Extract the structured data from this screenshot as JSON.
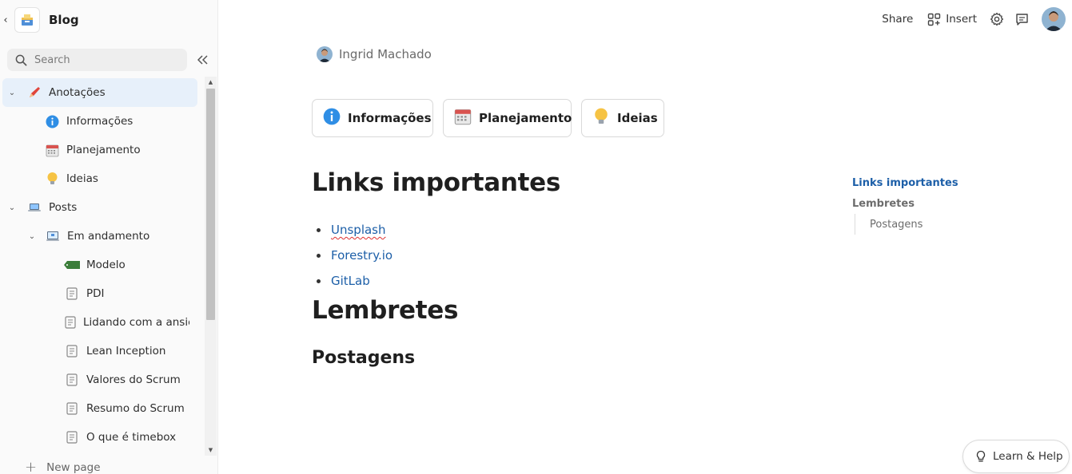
{
  "sidebar": {
    "space_title": "Blog",
    "search": {
      "placeholder": "Search",
      "value": ""
    },
    "items": [
      {
        "label": "Anotações",
        "icon": "pencil-icon",
        "caret": "expanded",
        "selected": true
      },
      {
        "label": "Informações",
        "icon": "info-icon"
      },
      {
        "label": "Planejamento",
        "icon": "calendar-icon"
      },
      {
        "label": "Ideias",
        "icon": "lightbulb-icon"
      },
      {
        "label": "Posts",
        "icon": "laptop-icon",
        "caret": "expanded"
      },
      {
        "label": "Em andamento",
        "icon": "laptop-draft-icon",
        "caret": "expanded"
      },
      {
        "label": "Modelo",
        "icon": "draft-tag-icon"
      },
      {
        "label": "PDI",
        "icon": "page-icon"
      },
      {
        "label": "Lidando com a ansiedade",
        "icon": "page-icon"
      },
      {
        "label": "Lean Inception",
        "icon": "page-icon"
      },
      {
        "label": "Valores do Scrum",
        "icon": "page-icon"
      },
      {
        "label": "Resumo do Scrum",
        "icon": "page-icon"
      },
      {
        "label": "O que é timebox",
        "icon": "page-icon"
      }
    ],
    "new_page_label": "New page"
  },
  "topbar": {
    "share_label": "Share",
    "insert_label": "Insert"
  },
  "page": {
    "author": "Ingrid Machado",
    "cards": [
      {
        "label": "Informações",
        "icon": "info-icon"
      },
      {
        "label": "Planejamento",
        "icon": "calendar-icon"
      },
      {
        "label": "Ideias",
        "icon": "lightbulb-icon"
      }
    ],
    "heading_links": "Links importantes",
    "links": [
      "Unsplash",
      "Forestry.io",
      "GitLab"
    ],
    "heading_lembretes": "Lembretes",
    "heading_postagens": "Postagens"
  },
  "toc": {
    "items": [
      "Links importantes",
      "Lembretes",
      "Postagens"
    ]
  },
  "help": {
    "label": "Learn & Help"
  },
  "colors": {
    "accent": "#1d5fa8",
    "selected_bg": "#e7f0fa",
    "sidebar_bg": "#fafafa"
  }
}
